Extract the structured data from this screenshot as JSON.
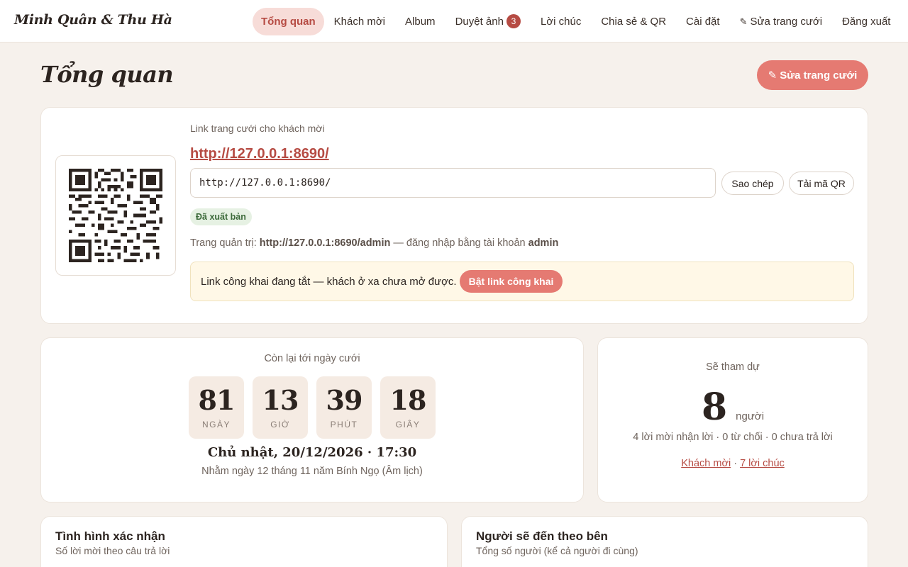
{
  "brand": "Minh Quân & Thu Hà",
  "nav": {
    "items": [
      {
        "label": "Tổng quan",
        "active": true
      },
      {
        "label": "Khách mời"
      },
      {
        "label": "Album"
      },
      {
        "label": "Duyệt ảnh",
        "badge": "3"
      },
      {
        "label": "Lời chúc"
      },
      {
        "label": "Chia sẻ & QR"
      },
      {
        "label": "Cài đặt"
      },
      {
        "label": "Sửa trang cưới",
        "icon": "pencil-icon"
      },
      {
        "label": "Đăng xuất"
      }
    ]
  },
  "header": {
    "title": "Tổng quan",
    "edit_button": "Sửa trang cưới"
  },
  "link_card": {
    "label": "Link trang cưới cho khách mời",
    "url": "http://127.0.0.1:8690/",
    "copy_button": "Sao chép",
    "qr_button": "Tải mã QR",
    "status": "Đã xuất bản",
    "admin_prefix": "Trang quản trị:",
    "admin_url": "http://127.0.0.1:8690/admin",
    "admin_mid": "— đăng nhập bằng tài khoản",
    "admin_user": "admin",
    "notice_text": "Link công khai đang tắt — khách ở xa chưa mở được.",
    "notice_button": "Bật link công khai"
  },
  "countdown": {
    "label": "Còn lại tới ngày cưới",
    "units": [
      {
        "value": "81",
        "unit": "NGÀY"
      },
      {
        "value": "13",
        "unit": "GIỜ"
      },
      {
        "value": "39",
        "unit": "PHÚT"
      },
      {
        "value": "18",
        "unit": "GIÂY"
      }
    ],
    "date": "Chủ nhật, 20/12/2026 · 17:30",
    "lunar": "Nhằm ngày 12 tháng 11 năm Bính Ngọ (Âm lịch)"
  },
  "attendance": {
    "label": "Sẽ tham dự",
    "count": "8",
    "unit": "người",
    "detail": "4 lời mời nhận lời · 0 từ chối · 0 chưa trả lời",
    "link_guests": "Khách mời",
    "separator": "·",
    "link_wishes": "7 lời chúc"
  },
  "confirm_card": {
    "title": "Tình hình xác nhận",
    "subtitle": "Số lời mời theo câu trả lời"
  },
  "side_card": {
    "title": "Người sẽ đến theo bên",
    "subtitle": "Tổng số người (kể cả người đi cùng)"
  },
  "colors": {
    "accent": "#e57a72",
    "accent_dark": "#b64b43",
    "background": "#f6f1ec",
    "published": "#3c6a3a"
  }
}
